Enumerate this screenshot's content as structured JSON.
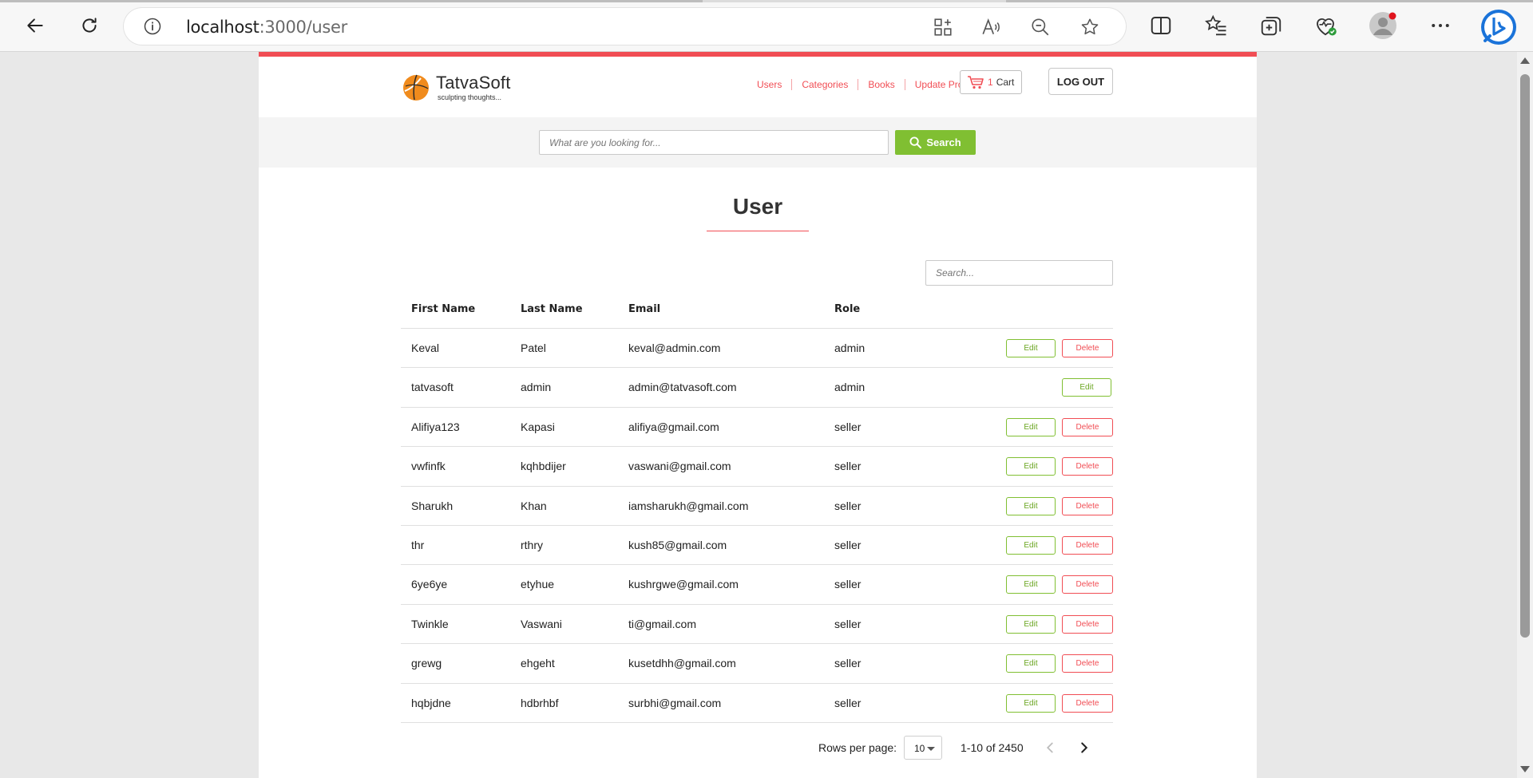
{
  "browser": {
    "url_host": "localhost",
    "url_path": ":3000/user"
  },
  "header": {
    "logo_name": "TatvaSoft",
    "logo_tagline": "sculpting thoughts...",
    "nav": [
      "Users",
      "Categories",
      "Books",
      "Update Profile"
    ],
    "cart_count": "1",
    "cart_label": "Cart",
    "logout_label": "LOG OUT"
  },
  "search": {
    "placeholder": "What are you looking for...",
    "button_label": "Search"
  },
  "page_title": "User",
  "table_search_placeholder": "Search...",
  "table": {
    "columns": [
      "First Name",
      "Last Name",
      "Email",
      "Role"
    ],
    "rows": [
      {
        "first": "Keval",
        "last": "Patel",
        "email": "keval@admin.com",
        "role": "admin",
        "actions": [
          "Edit",
          "Delete"
        ]
      },
      {
        "first": "tatvasoft",
        "last": "admin",
        "email": "admin@tatvasoft.com",
        "role": "admin",
        "actions": [
          "Edit"
        ]
      },
      {
        "first": "Alifiya123",
        "last": "Kapasi",
        "email": "alifiya@gmail.com",
        "role": "seller",
        "actions": [
          "Edit",
          "Delete"
        ]
      },
      {
        "first": "vwfinfk",
        "last": "kqhbdijer",
        "email": "vaswani@gmail.com",
        "role": "seller",
        "actions": [
          "Edit",
          "Delete"
        ]
      },
      {
        "first": "Sharukh",
        "last": "Khan",
        "email": "iamsharukh@gmail.com",
        "role": "seller",
        "actions": [
          "Edit",
          "Delete"
        ]
      },
      {
        "first": "thr",
        "last": "rthry",
        "email": "kush85@gmail.com",
        "role": "seller",
        "actions": [
          "Edit",
          "Delete"
        ]
      },
      {
        "first": "6ye6ye",
        "last": "etyhue",
        "email": "kushrgwe@gmail.com",
        "role": "seller",
        "actions": [
          "Edit",
          "Delete"
        ]
      },
      {
        "first": "Twinkle",
        "last": "Vaswani",
        "email": "ti@gmail.com",
        "role": "seller",
        "actions": [
          "Edit",
          "Delete"
        ]
      },
      {
        "first": "grewg",
        "last": "ehgeht",
        "email": "kusetdhh@gmail.com",
        "role": "seller",
        "actions": [
          "Edit",
          "Delete"
        ]
      },
      {
        "first": "hqbjdne",
        "last": "hdbrhbf",
        "email": "surbhi@gmail.com",
        "role": "seller",
        "actions": [
          "Edit",
          "Delete"
        ]
      }
    ]
  },
  "pagination": {
    "rows_per_page_label": "Rows per page:",
    "rows_per_page": "10",
    "range": "1-10 of 2450"
  },
  "colors": {
    "accent_red": "#f14d54",
    "accent_green": "#80bf32"
  }
}
